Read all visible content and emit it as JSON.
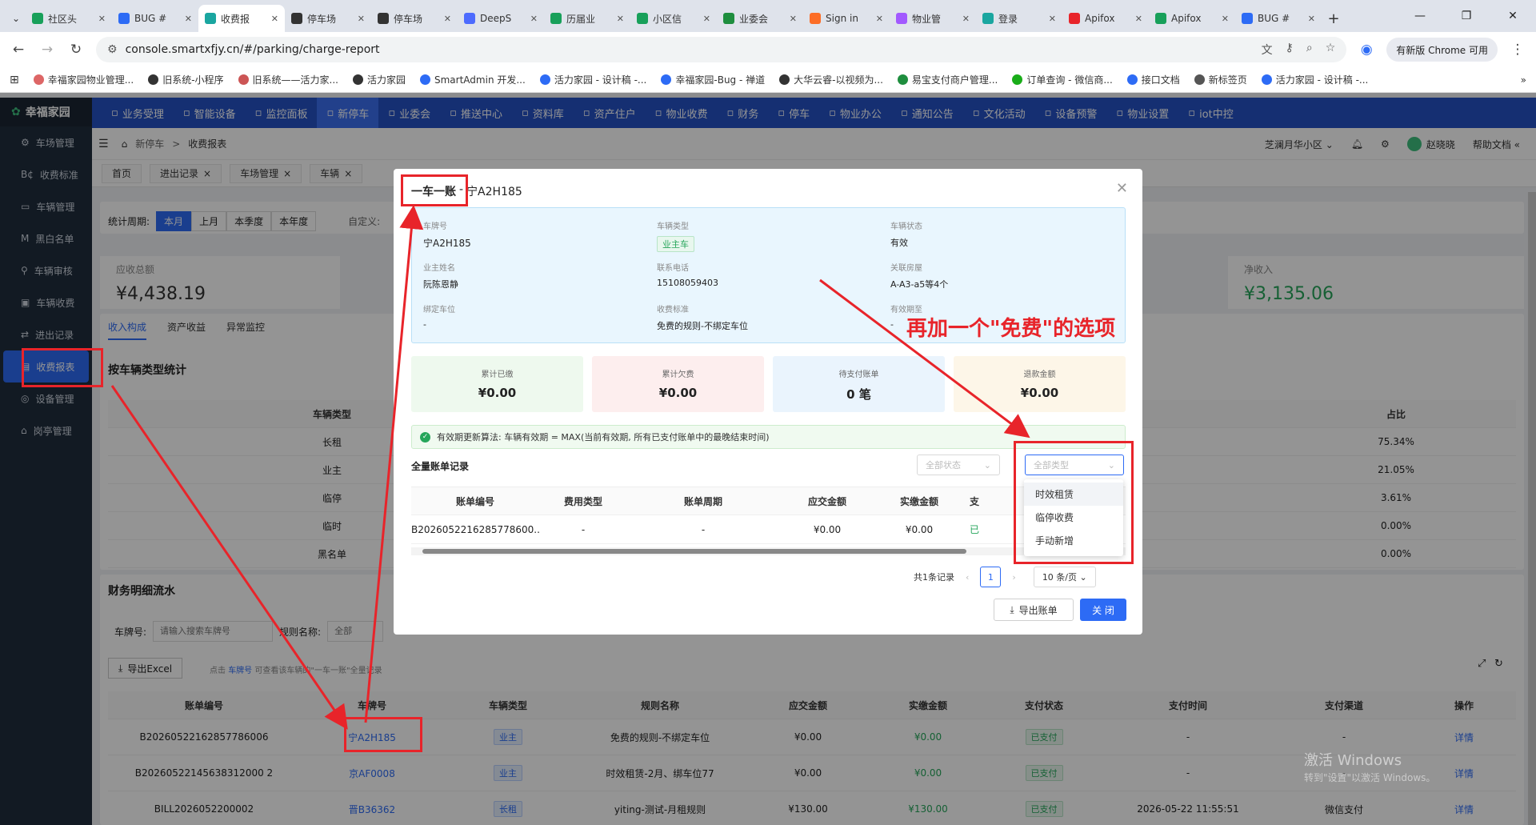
{
  "browser": {
    "tabs": [
      {
        "label": "社区头",
        "color": "#18a05a"
      },
      {
        "label": "BUG #",
        "color": "#2d6bf5"
      },
      {
        "label": "收费报",
        "color": "#1aa6a0",
        "active": true
      },
      {
        "label": "停车场",
        "color": "#333"
      },
      {
        "label": "停车场",
        "color": "#333"
      },
      {
        "label": "DeepS",
        "color": "#4d6bfe"
      },
      {
        "label": "历届业",
        "color": "#18a05a"
      },
      {
        "label": "小区信",
        "color": "#18a05a"
      },
      {
        "label": "业委会",
        "color": "#1e8e3e"
      },
      {
        "label": "Sign in",
        "color": "#fc6d26"
      },
      {
        "label": "物业管",
        "color": "#a259ff"
      },
      {
        "label": "登录",
        "color": "#1aa6a0"
      },
      {
        "label": "Apifox",
        "color": "#e8242a"
      },
      {
        "label": "Apifox",
        "color": "#18a05a"
      },
      {
        "label": "BUG #",
        "color": "#2d6bf5"
      }
    ],
    "url": "console.smartxfjy.cn/#/parking/charge-report",
    "update_label": "有新版 Chrome 可用",
    "bookmarks": [
      "幸福家园物业管理...",
      "旧系统-小程序",
      "旧系统——活力家...",
      "活力家园",
      "SmartAdmin 开发...",
      "活力家园 - 设计稿 -...",
      "幸福家园-Bug - 禅道",
      "大华云睿-以视频为...",
      "易宝支付商户管理...",
      "订单查询 - 微信商...",
      "接口文档",
      "新标签页",
      "活力家园 - 设计稿 -..."
    ]
  },
  "app": {
    "logo": "幸福家园",
    "sidebar": [
      "车场管理",
      "收费标准",
      "车辆管理",
      "黑白名单",
      "车辆审核",
      "车辆收费",
      "进出记录",
      "收费报表",
      "设备管理",
      "岗亭管理"
    ],
    "sidebar_active": "收费报表",
    "topnav": [
      "业务受理",
      "智能设备",
      "监控面板",
      "新停车",
      "业委会",
      "推送中心",
      "资料库",
      "资产住户",
      "物业收费",
      "财务",
      "停车",
      "物业办公",
      "通知公告",
      "文化活动",
      "设备预警",
      "物业设置",
      "iot中控"
    ],
    "topnav_active": "新停车",
    "breadcrumb": [
      "新停车",
      "收费报表"
    ],
    "community": "芝澜月华小区",
    "user": "赵晓晓",
    "help": "帮助文档",
    "pagetabs": [
      "首页",
      "进出记录",
      "车场管理",
      "车辆"
    ],
    "period_label": "统计周期:",
    "period_options": [
      "本月",
      "上月",
      "本季度",
      "本年度"
    ],
    "custom_label": "自定义:",
    "receivable_label": "应收总额",
    "receivable_value": "¥4,438.19",
    "net_label": "净收入",
    "net_value": "¥3,135.06",
    "subtabs": [
      "收入构成",
      "资产收益",
      "异常监控"
    ],
    "vehicle_stat_title": "按车辆类型统计",
    "vehicle_stat_header": [
      "车辆类型",
      "占比"
    ],
    "vehicle_stats": [
      {
        "type": "长租",
        "ratio": "75.34%"
      },
      {
        "type": "业主",
        "ratio": "21.05%"
      },
      {
        "type": "临停",
        "ratio": "3.61%"
      },
      {
        "type": "临时",
        "ratio": "0.00%"
      },
      {
        "type": "黑名单",
        "ratio": "0.00%"
      }
    ],
    "flow_title": "财务明细流水",
    "plate_filter_label": "车牌号:",
    "plate_filter_placeholder": "请输入搜索车牌号",
    "rule_filter_label": "规则名称:",
    "rule_filter_placeholder": "全部",
    "export_excel": "导出Excel",
    "hint_prefix": "点击",
    "hint_link": "车牌号",
    "hint_suffix": "可查看该车辆的\"一车一账\"全量记录",
    "flow_header": [
      "账单编号",
      "车牌号",
      "车辆类型",
      "规则名称",
      "应交金额",
      "实缴金额",
      "支付状态",
      "支付时间",
      "支付渠道",
      "操作"
    ],
    "flow_rows": [
      {
        "no": "B20260522162857786006",
        "plate": "宁A2H185",
        "vtype": "业主",
        "rule": "免费的规则-不绑定车位",
        "due": "¥0.00",
        "paid": "¥0.00",
        "status": "已支付",
        "time": "-",
        "channel": "-",
        "op": "详情"
      },
      {
        "no": "B20260522145638312000 2",
        "plate": "京AF0008",
        "vtype": "业主",
        "rule": "时效租赁-2月、绑车位77",
        "due": "¥0.00",
        "paid": "¥0.00",
        "status": "已支付",
        "time": "-",
        "channel": "-",
        "op": "详情"
      },
      {
        "no": "BILL2026052200002",
        "plate": "晋B36362",
        "vtype": "长租",
        "rule": "yiting-测试-月租规则",
        "due": "¥130.00",
        "paid": "¥130.00",
        "status": "已支付",
        "time": "2026-05-22 11:55:51",
        "channel": "微信支付",
        "op": "详情"
      }
    ]
  },
  "modal": {
    "title_main": "一车一账",
    "title_sep": "-",
    "title_plate": "宁A2H185",
    "info": {
      "plate_label": "车牌号",
      "plate_value": "宁A2H185",
      "vtype_label": "车辆类型",
      "vtype_value": "业主车",
      "vstatus_label": "车辆状态",
      "vstatus_value": "有效",
      "owner_label": "业主姓名",
      "owner_value": "阮陈恩静",
      "phone_label": "联系电话",
      "phone_value": "15108059403",
      "house_label": "关联房屋",
      "house_value": "A-A3-a5等4个",
      "spot_label": "绑定车位",
      "spot_value": "-",
      "std_label": "收费标准",
      "std_value": "免费的规则-不绑定车位",
      "valid_label": "有效期至",
      "valid_value": "-"
    },
    "summary": [
      {
        "label": "累计已缴",
        "value": "¥0.00",
        "bg": "#eef9ee"
      },
      {
        "label": "累计欠费",
        "value": "¥0.00",
        "bg": "#fdeeee"
      },
      {
        "label": "待支付账单",
        "value": "0 笔",
        "bg": "#eaf4fd"
      },
      {
        "label": "退款金额",
        "value": "¥0.00",
        "bg": "#fdf6e8"
      }
    ],
    "notice": "有效期更新算法: 车辆有效期 = MAX(当前有效期, 所有已支付账单中的最晚结束时间)",
    "records_title": "全量账单记录",
    "status_select_placeholder": "全部状态",
    "type_select_placeholder": "全部类型",
    "table_header": [
      "账单编号",
      "费用类型",
      "账单周期",
      "应交金额",
      "实缴金额",
      "支"
    ],
    "table_rows": [
      {
        "no": "B2026052216285778600...",
        "fee_type": "-",
        "period": "-",
        "due": "¥0.00",
        "paid": "¥0.00",
        "status": "已"
      }
    ],
    "total_label": "共1条记录",
    "page": "1",
    "page_size": "10 条/页",
    "export_label": "导出账单",
    "close_label": "关 闭",
    "type_options": [
      "时效租赁",
      "临停收费",
      "手动新增"
    ]
  },
  "annotation": {
    "text": "再加一个\"免费\"的选项",
    "color": "#e8242a"
  },
  "windows_watermark": {
    "line1": "激活 Windows",
    "line2": "转到\"设置\"以激活 Windows。"
  }
}
